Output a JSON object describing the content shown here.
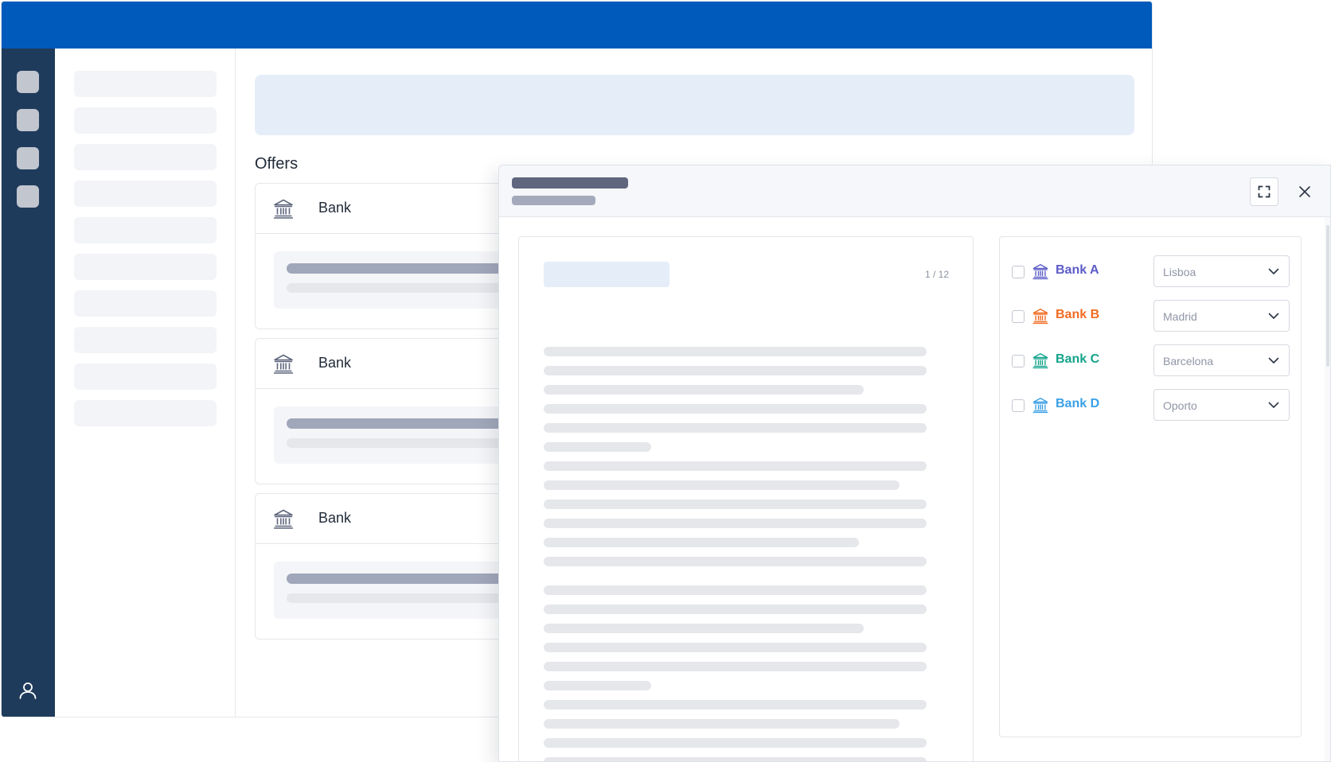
{
  "main": {
    "section_title": "Offers",
    "offers": [
      {
        "title": "Bank",
        "icon": "bank-icon"
      },
      {
        "title": "Bank",
        "icon": "bank-icon"
      },
      {
        "title": "Bank",
        "icon": "bank-icon"
      }
    ]
  },
  "modal": {
    "actions": {
      "expand_icon": "expand-icon",
      "close_icon": "close-icon"
    },
    "document": {
      "page_indicator": "1 / 12"
    },
    "banks": [
      {
        "label": "Bank A",
        "location": "Lisboa",
        "color": "#5b5bc8",
        "icon": "bank-icon"
      },
      {
        "label": "Bank B",
        "location": "Madrid",
        "color": "#f26b22",
        "icon": "bank-icon"
      },
      {
        "label": "Bank C",
        "location": "Barcelona",
        "color": "#14a38b",
        "icon": "bank-icon"
      },
      {
        "label": "Bank D",
        "location": "Oporto",
        "color": "#3aa0e6",
        "icon": "bank-icon"
      }
    ]
  },
  "colors": {
    "topbar": "#005abb",
    "rail": "#1f3b5c",
    "icon_neutral": "#5f667d"
  }
}
